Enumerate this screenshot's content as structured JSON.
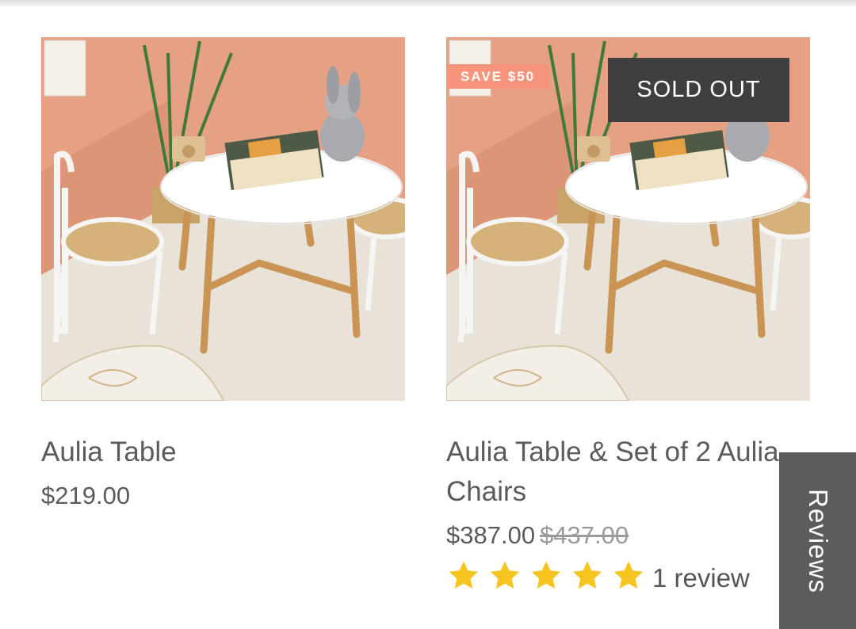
{
  "products": [
    {
      "title": "Aulia Table",
      "price": "$219.00"
    },
    {
      "title": "Aulia Table & Set of 2 Aulia Chairs",
      "badge_save": "SAVE $50",
      "badge_sold": "SOLD OUT",
      "price": "$387.00",
      "compare_price": "$437.00",
      "rating": 5,
      "review_count": "1 review"
    }
  ],
  "reviews_tab": {
    "label": "Reviews"
  },
  "colors": {
    "wall": "#e6a083",
    "floor": "#e8e2d8",
    "save_badge": "#f6957b",
    "sold_badge": "#3f3f41",
    "star": "#f7c51f",
    "reviews_tab": "#5c5c5e"
  }
}
